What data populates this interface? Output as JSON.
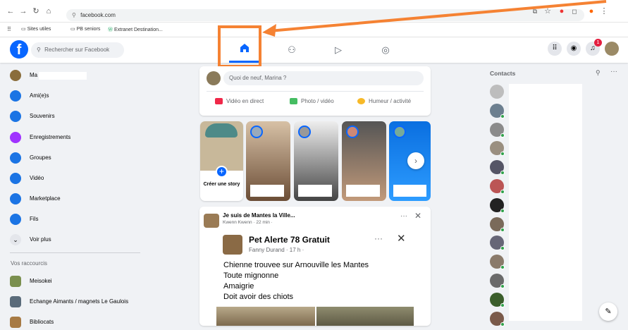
{
  "browser": {
    "url": "facebook.com",
    "bookmarks": [
      "Sites utiles",
      "PB seniors",
      "Extranet Destination..."
    ],
    "nav_icons": [
      "back-icon",
      "forward-icon",
      "reload-icon",
      "home-icon"
    ]
  },
  "header": {
    "logo": "f",
    "search_placeholder": "Rechercher sur Facebook",
    "tabs": [
      "home-icon",
      "friends-icon",
      "video-icon",
      "groups-icon"
    ],
    "notification_badge": "1"
  },
  "sidebar": {
    "items": [
      {
        "label": "Ma",
        "icon": "avatar-icon",
        "color": "#8a6d3b"
      },
      {
        "label": "Ami(e)s",
        "icon": "friends-icon",
        "color": "#1b74e4"
      },
      {
        "label": "Souvenirs",
        "icon": "clock-icon",
        "color": "#1b74e4"
      },
      {
        "label": "Enregistrements",
        "icon": "bookmark-icon",
        "color": "#a033ff"
      },
      {
        "label": "Groupes",
        "icon": "groups-icon",
        "color": "#1b74e4"
      },
      {
        "label": "Vidéo",
        "icon": "video-icon",
        "color": "#1b74e4"
      },
      {
        "label": "Marketplace",
        "icon": "shop-icon",
        "color": "#1b74e4"
      },
      {
        "label": "Fils",
        "icon": "feeds-icon",
        "color": "#1b74e4"
      },
      {
        "label": "Voir plus",
        "icon": "chevron-down-icon",
        "color": "#e4e6eb"
      }
    ],
    "shortcuts_title": "Vos raccourcis",
    "shortcuts": [
      {
        "label": "Meisokei"
      },
      {
        "label": "Echange Aimants / magnets Le Gaulois"
      },
      {
        "label": "Bibliocats"
      }
    ]
  },
  "composer": {
    "placeholder": "Quoi de neuf, Marina ?",
    "actions": [
      {
        "label": "Vidéo en direct",
        "icon": "live-video-icon",
        "color": "#f02849"
      },
      {
        "label": "Photo / vidéo",
        "icon": "photo-icon",
        "color": "#45bd62"
      },
      {
        "label": "Humeur / activité",
        "icon": "smiley-icon",
        "color": "#f7b928"
      }
    ]
  },
  "stories": {
    "create_label": "Créer une story",
    "next_icon": "chevron-right-icon"
  },
  "post": {
    "group_name": "Je suis de Mantes la Ville...",
    "author_meta": "Kwenn Kwenn · 22 min ·",
    "shared": {
      "title": "Pet Alerte 78 Gratuit",
      "author": "Fanny Durand · 17 h ·",
      "lines": [
        "Chienne trouvee sur Arnouville les Mantes",
        "Toute mignonne",
        "Amaigrie",
        "Doit avoir des chiots"
      ]
    }
  },
  "contacts": {
    "title": "Contacts",
    "count": 13
  },
  "annotation": {
    "arrow_color": "#f58233"
  }
}
